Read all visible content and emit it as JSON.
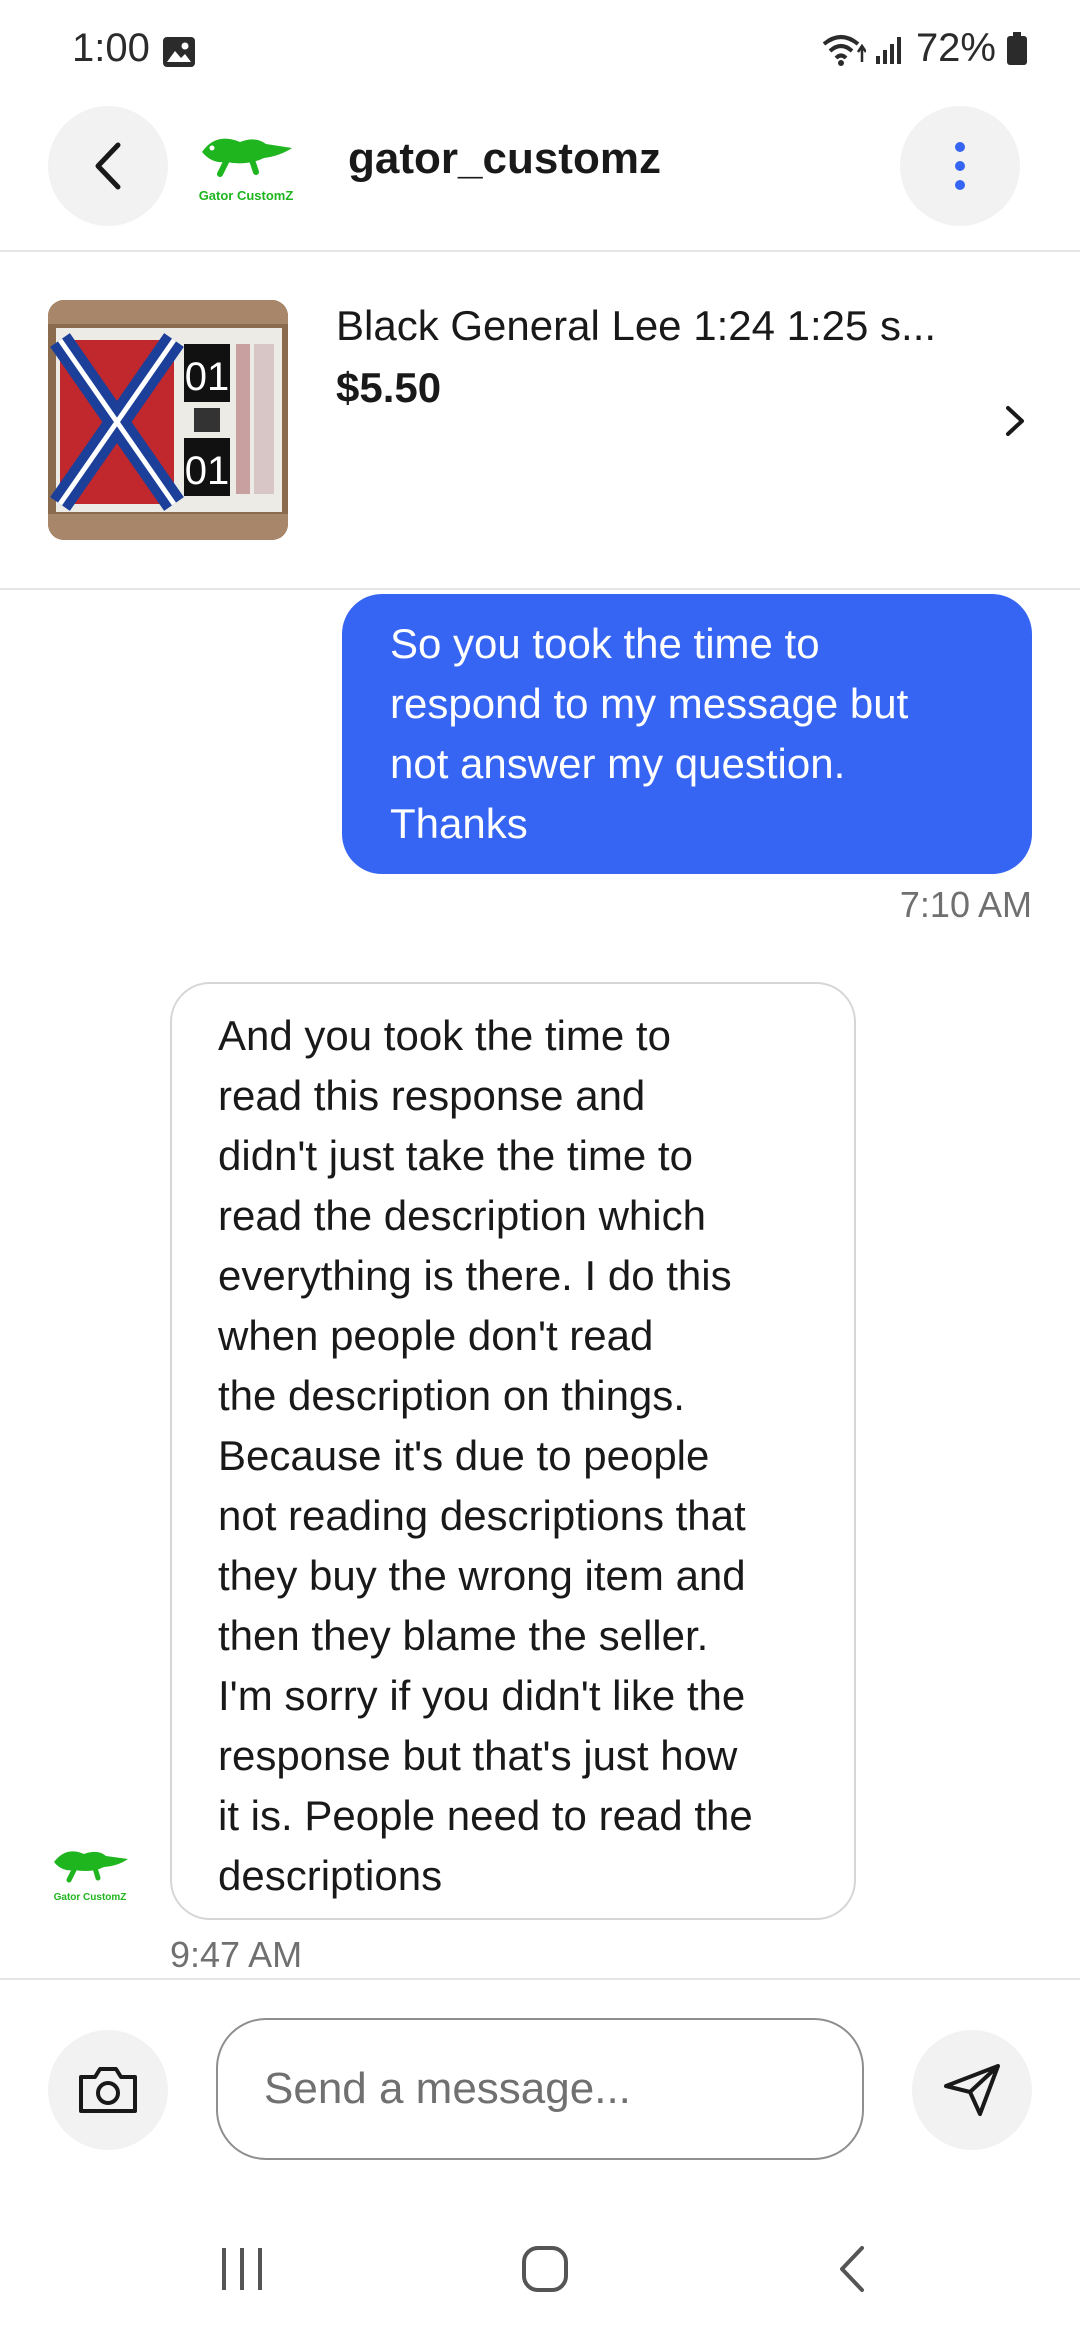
{
  "status_bar": {
    "time": "1:00",
    "battery": "72%",
    "icons": [
      "image-icon",
      "wifi-icon",
      "signal-icon",
      "battery-icon"
    ]
  },
  "header": {
    "seller_name": "gator_customz",
    "logo_text": "Gator CustomZ",
    "back_icon": "back-arrow-icon",
    "more_icon": "more-vertical-icon"
  },
  "item": {
    "title": "Black General Lee 1:24 1:25 s...",
    "price": "$5.50",
    "chevron_icon": "chevron-right-icon"
  },
  "messages": [
    {
      "direction": "outgoing",
      "lines": [
        "So you took the time to",
        "respond to my message but",
        "not answer my question.",
        "Thanks"
      ],
      "time": "7:10 AM"
    },
    {
      "direction": "incoming",
      "lines": [
        "And you took the time to",
        "read this response and",
        "didn't just take the time to",
        "read the description which",
        "everything is there. I do this",
        "when people don't read",
        "the description on things.",
        "Because it's due to people",
        "not reading descriptions that",
        "they buy the wrong item and",
        "then they blame the seller.",
        "I'm sorry if you didn't like the",
        "response but that's just how",
        "it is. People need to read the",
        "descriptions"
      ],
      "time": "9:47 AM"
    }
  ],
  "composer": {
    "placeholder": "Send a message...",
    "camera_icon": "camera-icon",
    "send_icon": "send-icon"
  },
  "colors": {
    "accent": "#3665f3",
    "logo_green": "#1fb51f",
    "text": "#191919",
    "muted": "#707070"
  }
}
